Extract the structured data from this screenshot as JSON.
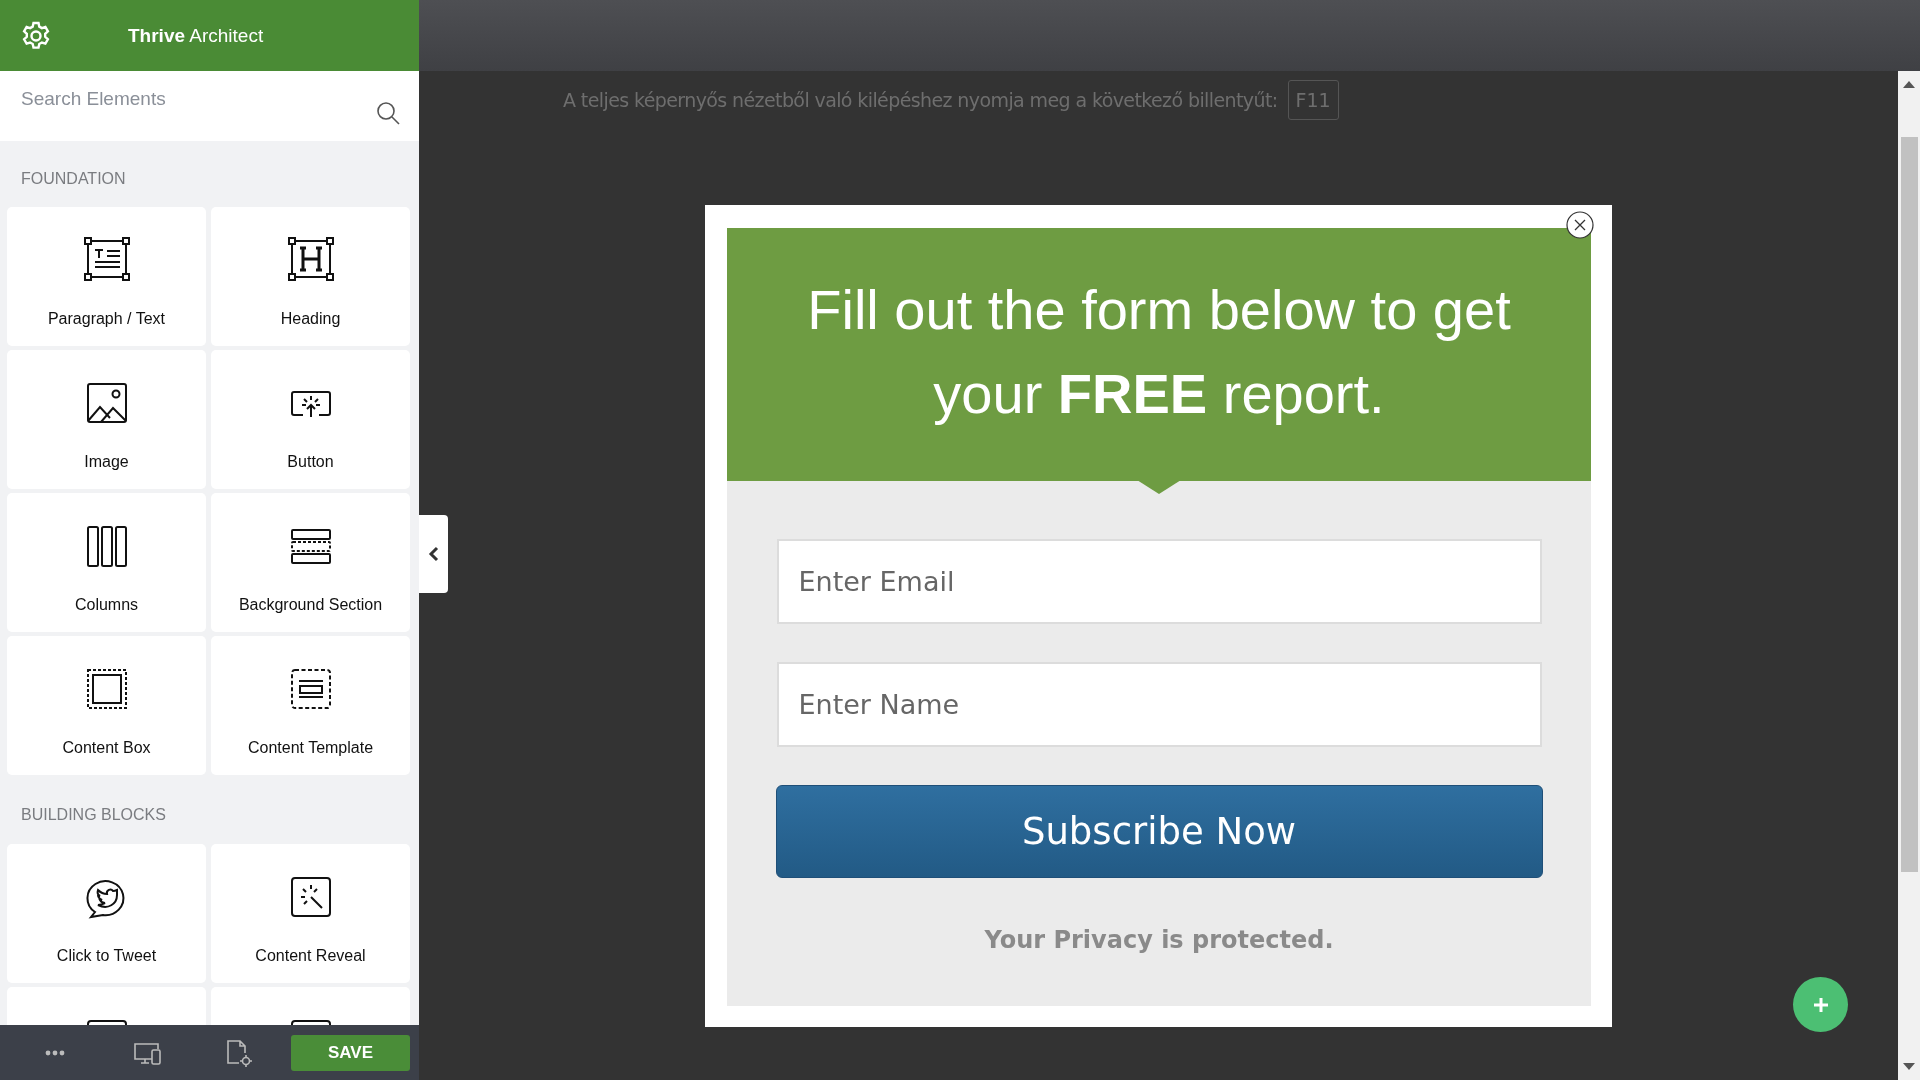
{
  "sidebar": {
    "title": "**Thrive** Architect",
    "search": {
      "placeholder": "Search Elements"
    },
    "sections": [
      {
        "label": "FOUNDATION",
        "elements": [
          {
            "kind": "paragraph",
            "label": "Paragraph / Text"
          },
          {
            "kind": "heading",
            "label": "Heading"
          },
          {
            "kind": "image",
            "label": "Image"
          },
          {
            "kind": "button",
            "label": "Button"
          },
          {
            "kind": "columns",
            "label": "Columns"
          },
          {
            "kind": "section",
            "label": "Background Section"
          },
          {
            "kind": "contentbox",
            "label": "Content Box"
          },
          {
            "kind": "template",
            "label": "Content Template"
          }
        ]
      },
      {
        "label": "BUILDING BLOCKS",
        "elements": [
          {
            "kind": "tweet",
            "label": "Click to Tweet"
          },
          {
            "kind": "reveal",
            "label": "Content Reveal"
          },
          {
            "kind": "clipped"
          },
          {
            "kind": "clipped"
          }
        ]
      }
    ],
    "footer": {
      "save": "SAVE"
    }
  },
  "notice": {
    "text": "A teljes képernyős nézetből való kilépéshez nyomja meg a következő billentyűt:",
    "key": "F11"
  },
  "popup": {
    "heading": "Fill out the form below to get your **FREE** report.",
    "fields": [
      {
        "placeholder": "Enter Email"
      },
      {
        "placeholder": "Enter Name"
      }
    ],
    "button": "Subscribe Now",
    "privacy": "Your Privacy is protected."
  }
}
